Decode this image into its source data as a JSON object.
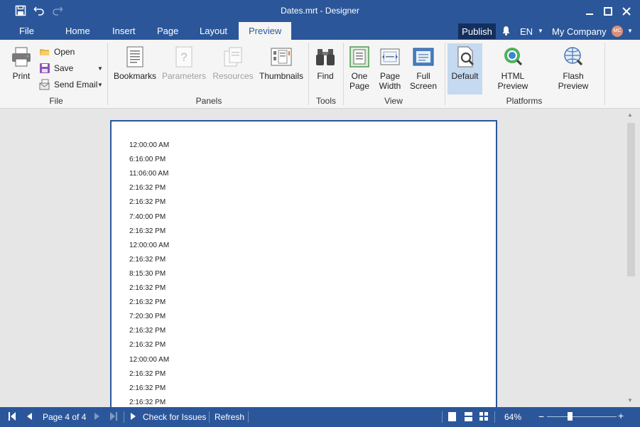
{
  "window": {
    "title": "Dates.mrt - Designer"
  },
  "quick_access": {
    "icons": [
      "save-icon",
      "undo-icon",
      "redo-icon"
    ]
  },
  "tabs": [
    {
      "label": "File"
    },
    {
      "label": "Home"
    },
    {
      "label": "Insert"
    },
    {
      "label": "Page"
    },
    {
      "label": "Layout"
    },
    {
      "label": "Preview",
      "active": true
    }
  ],
  "header_right": {
    "publish": "Publish",
    "language": "EN",
    "company": "My Company",
    "avatar": "MC"
  },
  "ribbon": {
    "file": {
      "label": "File",
      "print": "Print",
      "open": "Open",
      "save": "Save",
      "send_email": "Send Email"
    },
    "panels": {
      "label": "Panels",
      "bookmarks": "Bookmarks",
      "parameters": "Parameters",
      "resources": "Resources",
      "thumbnails": "Thumbnails"
    },
    "tools": {
      "label": "Tools",
      "find": "Find"
    },
    "view": {
      "label": "View",
      "one_page_1": "One",
      "one_page_2": "Page",
      "page_width_1": "Page",
      "page_width_2": "Width",
      "full_screen_1": "Full",
      "full_screen_2": "Screen"
    },
    "platforms": {
      "label": "Platforms",
      "default": "Default",
      "html_preview": "HTML Preview",
      "flash_preview": "Flash Preview"
    }
  },
  "report_rows": [
    "12:00:00 AM",
    "6:16:00 PM",
    "11:06:00 AM",
    "2:16:32 PM",
    "2:16:32 PM",
    "7:40:00 PM",
    "2:16:32 PM",
    "12:00:00 AM",
    "2:16:32 PM",
    "8:15:30 PM",
    "2:16:32 PM",
    "2:16:32 PM",
    "7:20:30 PM",
    "2:16:32 PM",
    "2:16:32 PM",
    "12:00:00 AM",
    "2:16:32 PM",
    "2:16:32 PM",
    "2:16:32 PM"
  ],
  "status": {
    "page_info": "Page 4 of 4",
    "check_issues": "Check for Issues",
    "refresh": "Refresh",
    "zoom": "64%",
    "zoom_slider_fraction": 0.33
  },
  "colors": {
    "accent": "#2b579a",
    "publish_bg": "#132f5e",
    "selected": "#c5d9f1"
  }
}
